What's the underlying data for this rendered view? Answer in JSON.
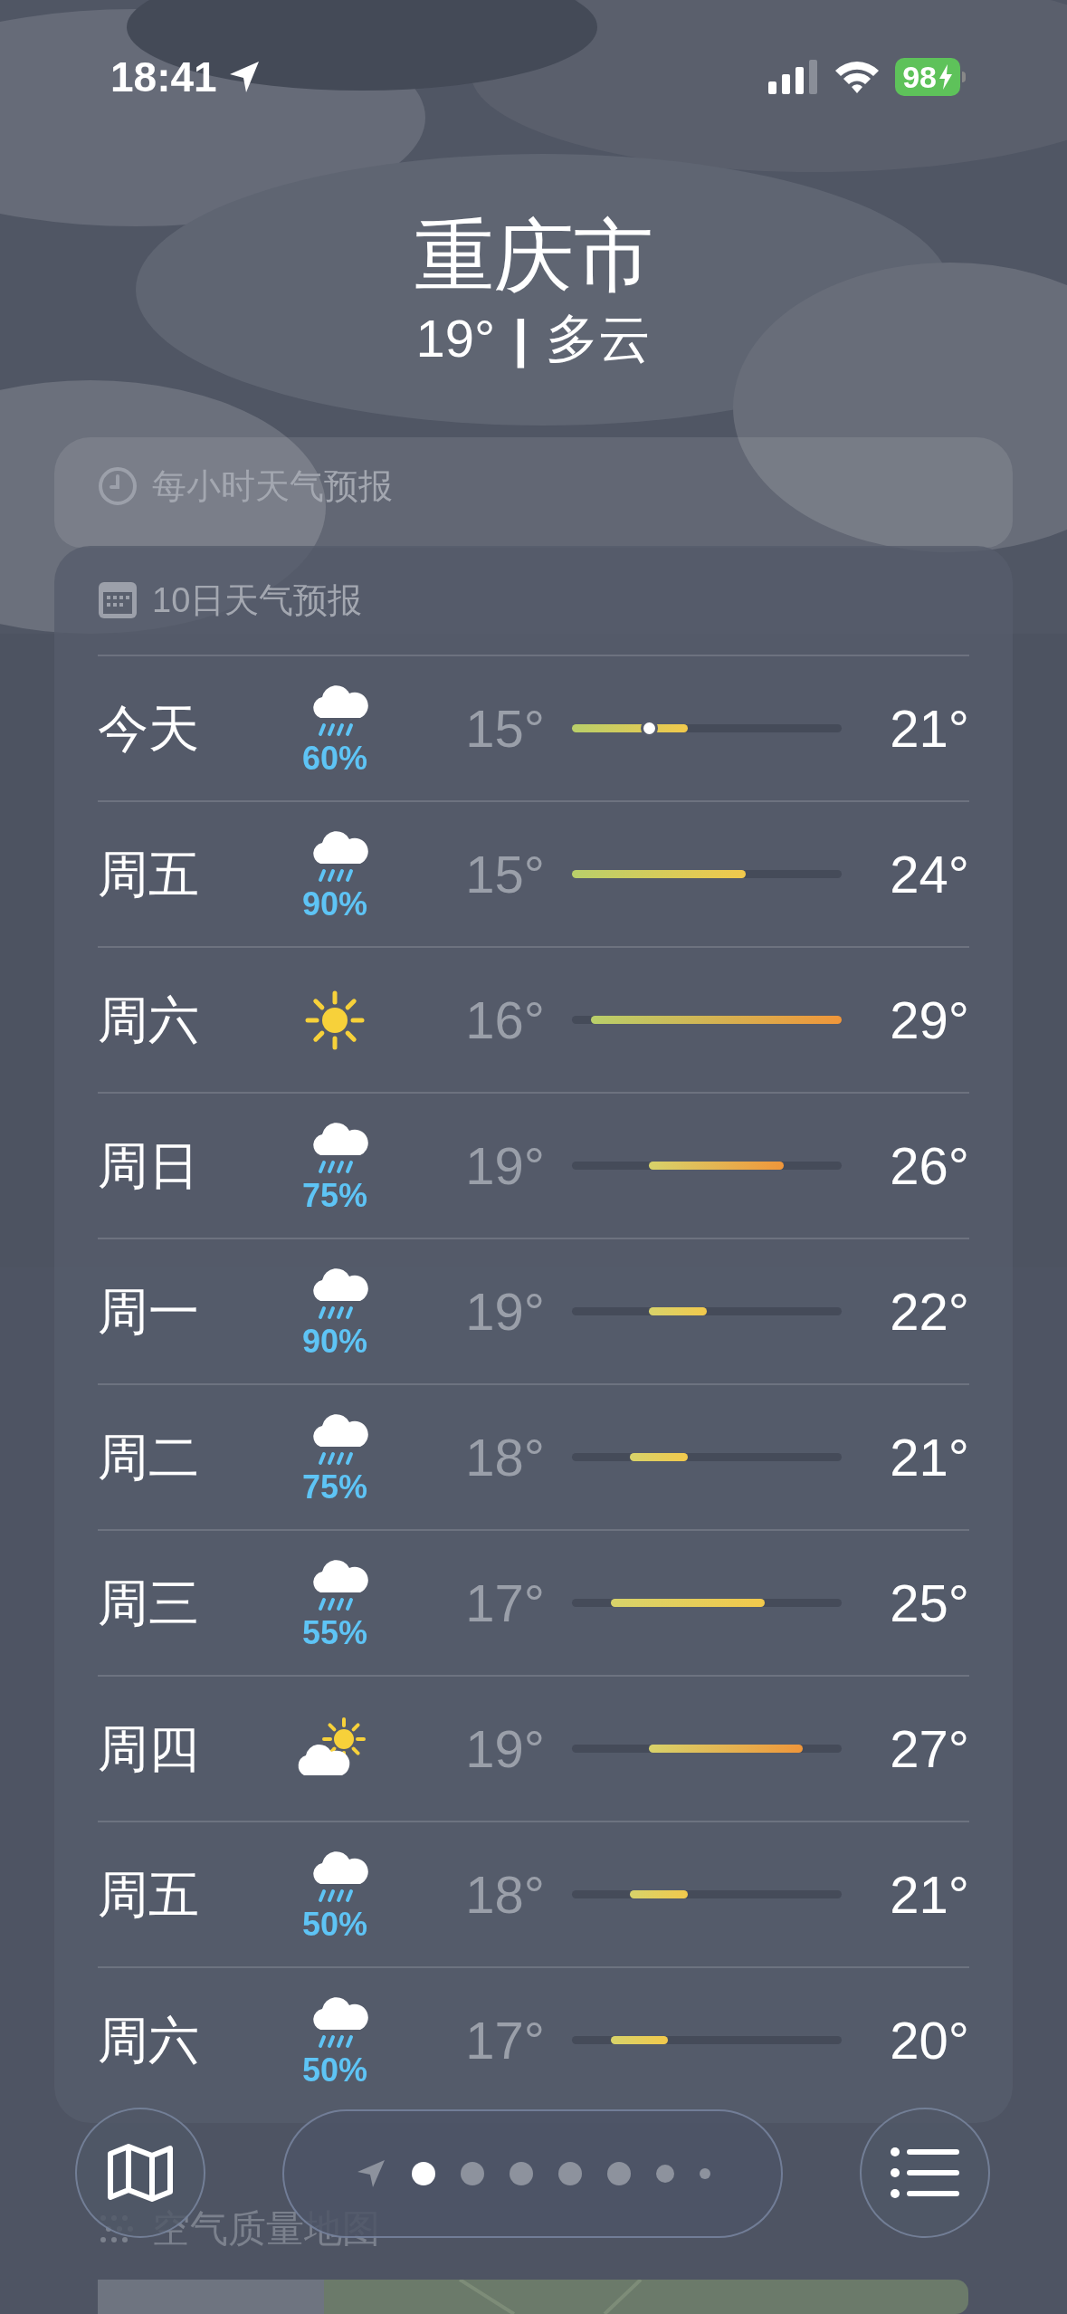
{
  "status_bar": {
    "time": "18:41",
    "battery": "98"
  },
  "location": {
    "city": "重庆市",
    "temperature": "19°",
    "separator": "|",
    "condition": "多云"
  },
  "hourly_forecast": {
    "title": "每小时天气预报"
  },
  "ten_day_forecast": {
    "title": "10日天气预报",
    "days": [
      {
        "day": "今天",
        "kind": "rain",
        "precip": "60%",
        "low": "15°",
        "high": "21°",
        "current_marker": true
      },
      {
        "day": "周五",
        "kind": "rain",
        "precip": "90%",
        "low": "15°",
        "high": "24°",
        "current_marker": false
      },
      {
        "day": "周六",
        "kind": "sun",
        "low": "16°",
        "high": "29°",
        "current_marker": false
      },
      {
        "day": "周日",
        "kind": "rain",
        "precip": "75%",
        "low": "19°",
        "high": "26°",
        "current_marker": false
      },
      {
        "day": "周一",
        "kind": "rain",
        "precip": "90%",
        "low": "19°",
        "high": "22°",
        "current_marker": false
      },
      {
        "day": "周二",
        "kind": "rain",
        "precip": "75%",
        "low": "18°",
        "high": "21°",
        "current_marker": false
      },
      {
        "day": "周三",
        "kind": "rain",
        "precip": "55%",
        "low": "17°",
        "high": "25°",
        "current_marker": false
      },
      {
        "day": "周四",
        "kind": "partly_sunny",
        "low": "19°",
        "high": "27°",
        "current_marker": false
      },
      {
        "day": "周五",
        "kind": "rain",
        "precip": "50%",
        "low": "18°",
        "high": "21°",
        "current_marker": false
      },
      {
        "day": "周六",
        "kind": "rain",
        "precip": "50%",
        "low": "17°",
        "high": "20°",
        "current_marker": false
      }
    ]
  },
  "air_quality": {
    "title": "空气质量地图"
  },
  "page_dots": [
    {
      "selected": true
    },
    {
      "selected": false
    },
    {
      "selected": false
    },
    {
      "selected": false
    },
    {
      "selected": false
    },
    {
      "selected": false
    },
    {
      "selected": false
    }
  ]
}
